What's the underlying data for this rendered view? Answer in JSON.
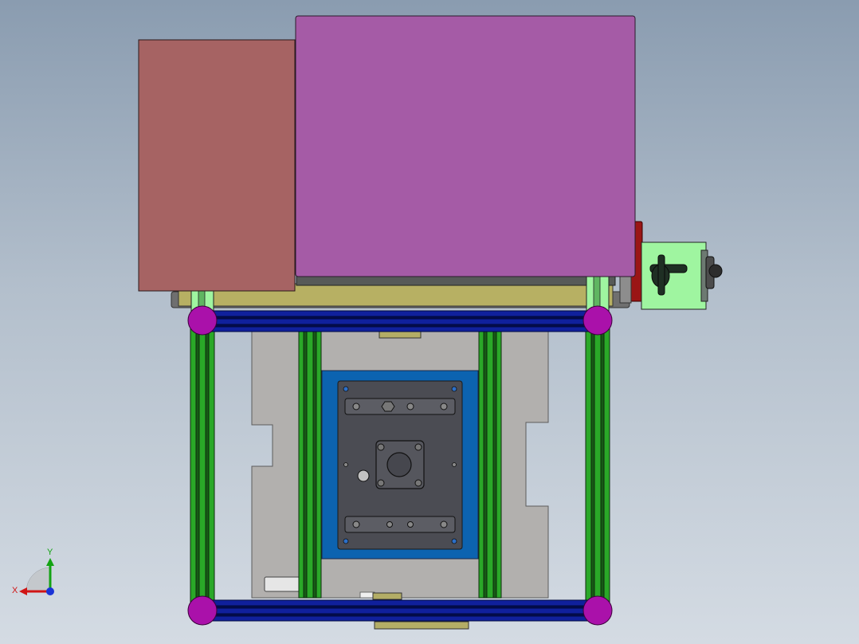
{
  "viewport": {
    "triad": {
      "x_label": "X",
      "y_label": "Y"
    }
  },
  "colors": {
    "housing": "#a66363",
    "cover": "#a55ba6",
    "frame_bar": "#0f1e9a",
    "frame_post": "#27a626",
    "corner_joint": "#aa11aa",
    "light_green": "#9ff5a0",
    "base_plate": "#b0aeac",
    "blue_plate": "#0b63b1",
    "mold_plate": "#4a4b52",
    "khaki_rail": "#b7b063",
    "motor_body": "#9ff5a0",
    "handwheel": "#1e2e23",
    "bracket_red": "#9a1515"
  }
}
